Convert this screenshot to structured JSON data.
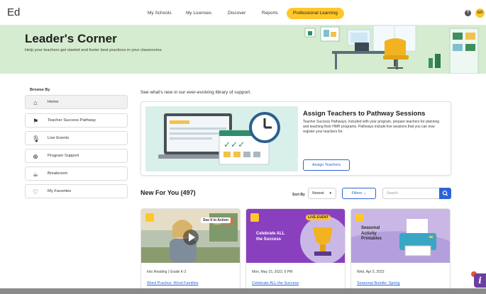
{
  "app": {
    "logo": "Ed"
  },
  "nav": {
    "items": [
      "My Schools",
      "My Licenses",
      "Discover",
      "Reports",
      "Professional Learning"
    ],
    "active": "Professional Learning",
    "help_icon": "help-circle-icon",
    "avatar_initials": "GO"
  },
  "hero": {
    "title": "Leader's Corner",
    "subtitle": "Help your teachers get started and foster best practices in your classrooms."
  },
  "sidebar": {
    "heading": "Browse By",
    "items": [
      {
        "label": "Home",
        "icon": "home-icon",
        "glyph": "⌂",
        "active": true
      },
      {
        "label": "Teacher Success Pathway",
        "icon": "flag-icon",
        "glyph": "⚑",
        "active": false
      },
      {
        "label": "Live Events",
        "icon": "microphone-icon",
        "glyph": "🎙",
        "active": false
      },
      {
        "label": "Program Support",
        "icon": "globe-icon",
        "glyph": "⊕",
        "active": false
      },
      {
        "label": "Breakroom",
        "icon": "coffee-cup-icon",
        "glyph": "☕",
        "active": false
      },
      {
        "label": "My Favorites",
        "icon": "heart-icon",
        "glyph": "♡",
        "active": false
      }
    ]
  },
  "main": {
    "intro": "See what's new in our ever-evolving library of support.",
    "feature": {
      "title": "Assign Teachers to Pathway Sessions",
      "description": "Teacher Success Pathways, included with your program, prepare teachers for planning and teaching their HMH programs. Pathways include live sessions that you can now register your teachers for.",
      "button": "Assign Teachers"
    },
    "new_for_you": {
      "title": "New For You (497)",
      "sort_label": "Sort By",
      "sort_value": "Newest",
      "filters_label": "Filters",
      "search_placeholder": "Search"
    },
    "cards": [
      {
        "meta": "Into Reading | Grade K-2",
        "title": "Word Practice: Word Families",
        "badge_icon": "play-icon",
        "image_tag": "See It in Action",
        "image_text": ""
      },
      {
        "meta": "Mon, May 15, 2023, 6 PM",
        "title": "Celebrate ALL the Success",
        "badge_icon": "calendar-icon",
        "image_tag": "LIVE EVENT",
        "image_text": "Celebrate ALL the Success"
      },
      {
        "meta": "Wed, Apr 5, 2023",
        "title": "Seasonal Bundle: Spring",
        "badge_icon": "document-icon",
        "image_tag": "",
        "image_text": "Seasonal Activity Printables"
      }
    ]
  },
  "colors": {
    "accent_yellow": "#ffc72c",
    "hero_green": "#d6ecd0",
    "link_blue": "#2c64d8",
    "card_purple": "#8a3fbf",
    "card_lavender": "#c9b8e6"
  }
}
